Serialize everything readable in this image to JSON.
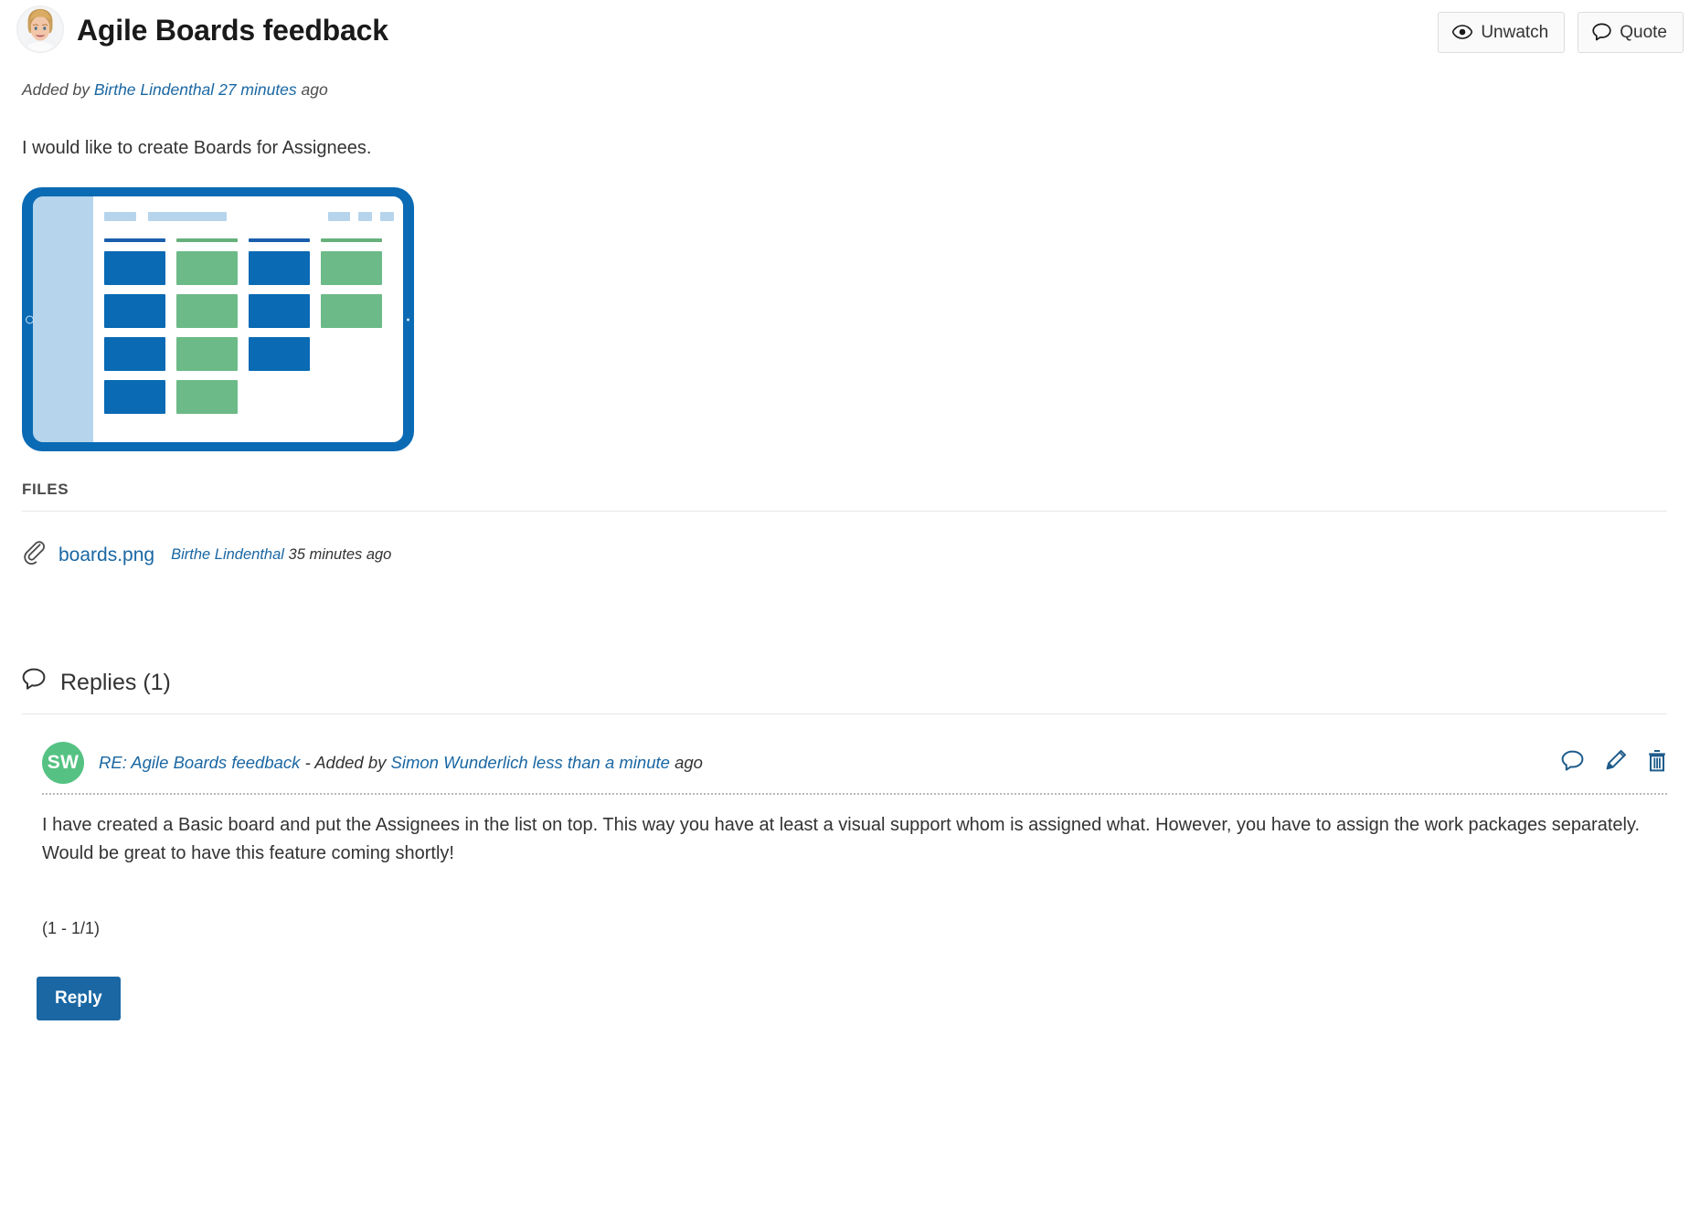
{
  "header": {
    "title": "Agile Boards feedback",
    "avatar_name": "author-photo",
    "actions": [
      {
        "label": "Unwatch",
        "icon": "eye-icon"
      },
      {
        "label": "Quote",
        "icon": "speech-bubble-icon"
      }
    ]
  },
  "topic": {
    "added_by_prefix": "Added by",
    "author": "Birthe Lindenthal",
    "time": "27 minutes",
    "time_suffix": "ago",
    "body": "I would like to create Boards for Assignees."
  },
  "attachment_image": {
    "alt": "boards.png preview showing a tablet with a kanban board",
    "colors": {
      "tablet_frame": "#0a6ab4",
      "screen_bg": "#b6d4ec",
      "canvas_bg": "#ffffff",
      "card_blue": "#0a6ab4",
      "card_green": "#6cba87",
      "rule_blue": "#1b5fac",
      "rule_green": "#66b07c"
    },
    "toolbar_chips": [
      "w1",
      "w2",
      "w3",
      "w4",
      "w5"
    ],
    "columns": [
      {
        "rule": "blue",
        "cards": [
          "blue",
          "blue",
          "blue",
          "blue"
        ]
      },
      {
        "rule": "green",
        "cards": [
          "green",
          "green",
          "green",
          "green"
        ]
      },
      {
        "rule": "blue",
        "cards": [
          "blue",
          "blue",
          "blue"
        ]
      },
      {
        "rule": "green",
        "cards": [
          "green",
          "green"
        ]
      }
    ]
  },
  "files": {
    "label": "FILES",
    "items": [
      {
        "icon": "paperclip-icon",
        "name": "boards.png",
        "author": "Birthe Lindenthal",
        "time": "35 minutes ago"
      }
    ]
  },
  "replies": {
    "icon": "speech-bubble-icon",
    "heading": "Replies (1)",
    "list": [
      {
        "avatar_initials": "SW",
        "avatar_color": "#55c283",
        "subject": "RE: Agile Boards feedback",
        "separator": "-",
        "added_by_prefix": "Added by",
        "author": "Simon Wunderlich",
        "time": "less than a minute",
        "time_suffix": "ago",
        "actions": [
          {
            "name": "quote",
            "icon": "speech-bubble-icon"
          },
          {
            "name": "edit",
            "icon": "pencil-icon"
          },
          {
            "name": "delete",
            "icon": "trash-icon"
          }
        ],
        "paragraphs": [
          "I have created a Basic board and put the Assignees in the list on top. This way you have at least a visual support whom is assigned what. However, you have to assign the work packages separately.",
          "Would be great to have this feature coming shortly!"
        ]
      }
    ],
    "pagination": "(1 - 1/1)",
    "reply_button": "Reply"
  },
  "theme": {
    "accent": "#1a67a3",
    "link": "#1a67a3",
    "text": "#333333",
    "divider": "#e7e7e7"
  }
}
